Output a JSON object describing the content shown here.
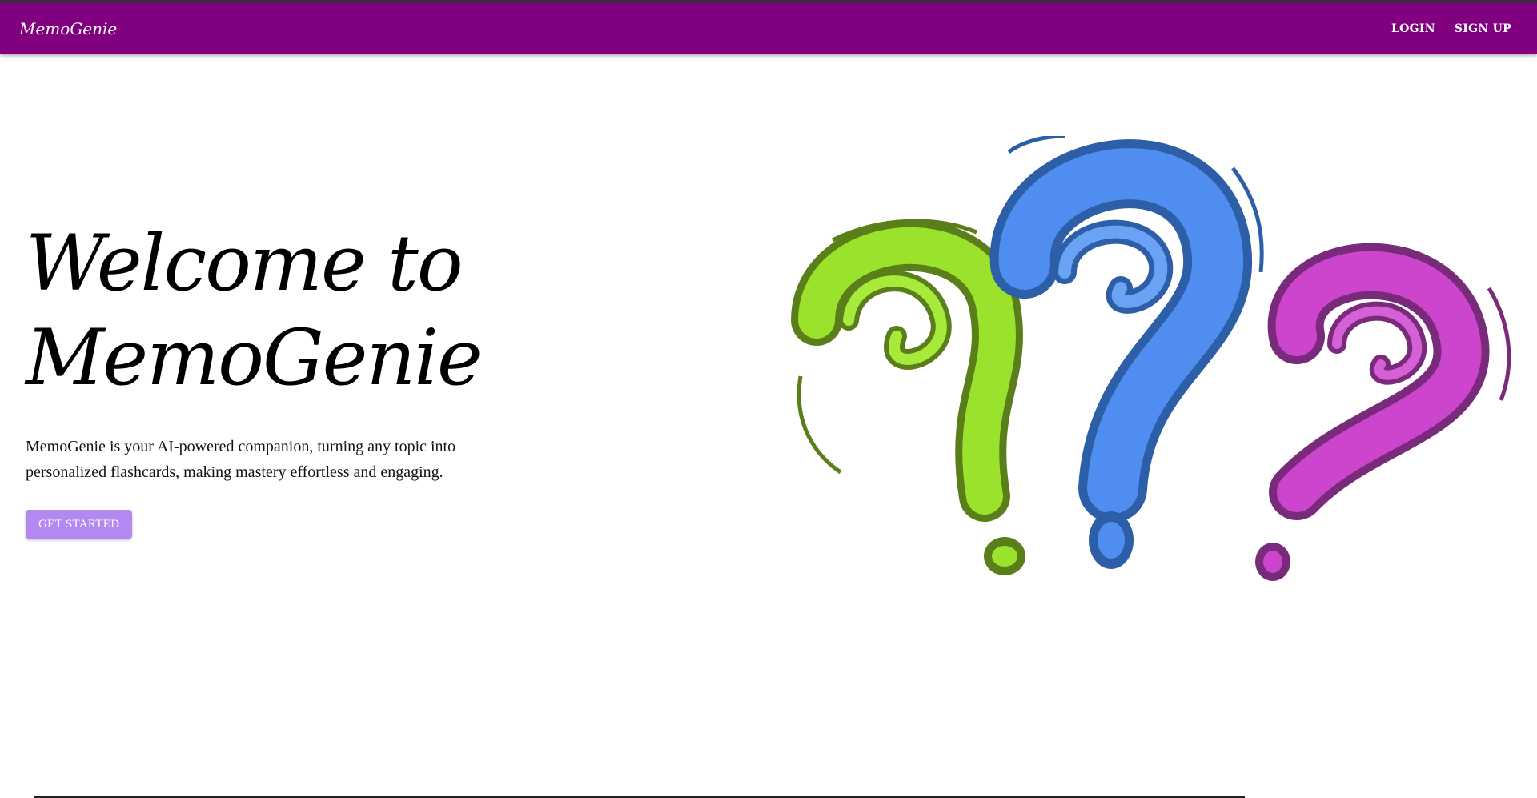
{
  "header": {
    "brand": "MemoGenie",
    "nav": {
      "login": "LOGIN",
      "signup": "SIGN UP"
    },
    "color": "#800080"
  },
  "hero": {
    "title_line1": "Welcome to",
    "title_line2": "MemoGenie",
    "description": "MemoGenie is your AI-powered companion, turning any topic into personalized flashcards, making mastery effortless and engaging.",
    "cta_label": "GET STARTED",
    "cta_color": "#b388f0"
  },
  "illustration": {
    "icon": "question-marks-illustration",
    "colors": [
      "#7ed321",
      "#3f7fe0",
      "#c040c0"
    ]
  }
}
